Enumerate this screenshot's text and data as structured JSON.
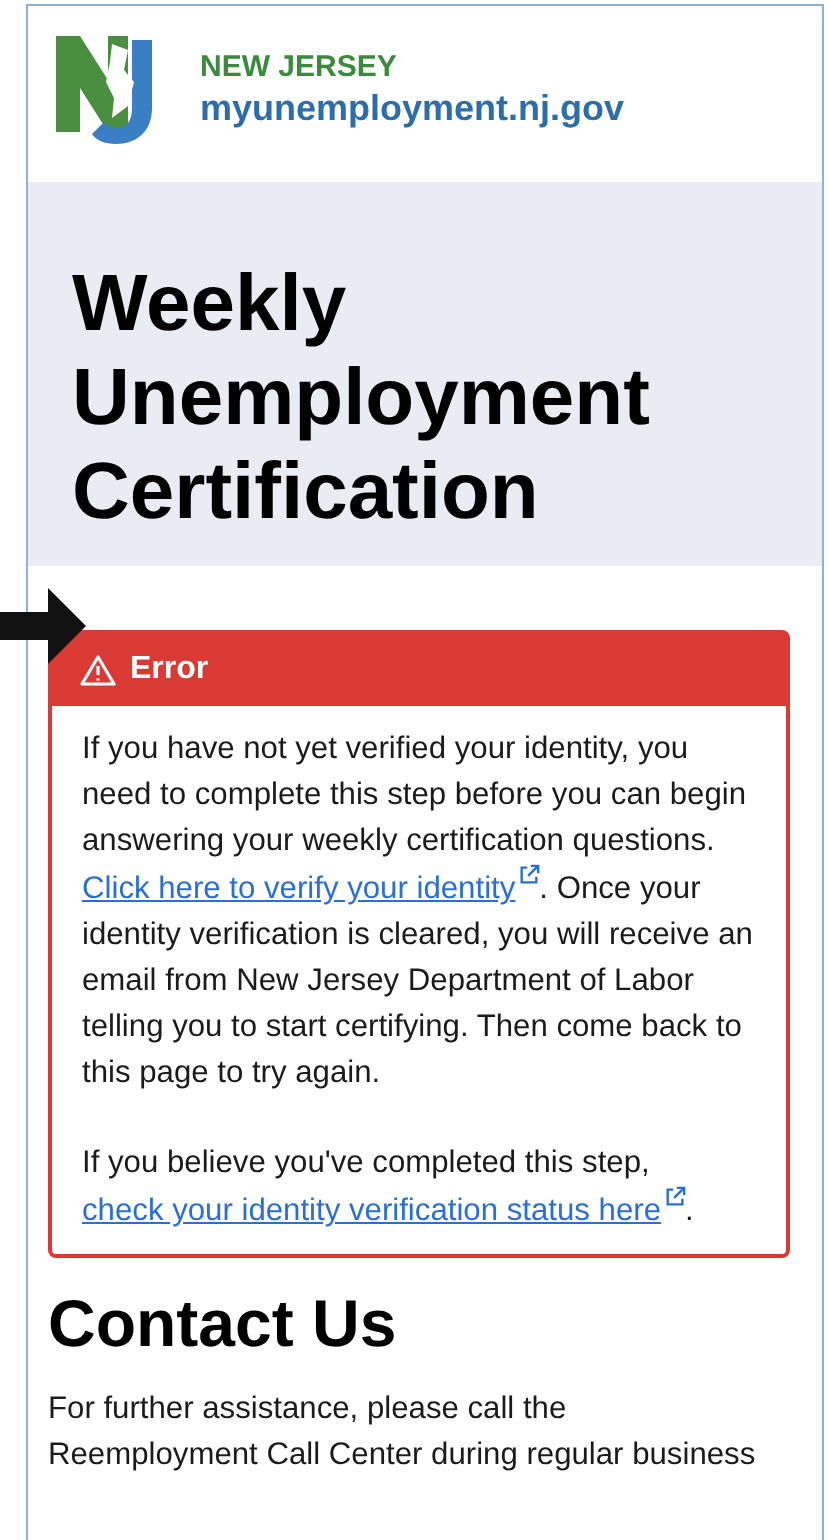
{
  "header": {
    "state": "NEW JERSEY",
    "site": "myunemployment.nj.gov"
  },
  "page_title": "Weekly Unemployment Certification",
  "alert": {
    "kind": "error",
    "title": "Error",
    "paragraphs": [
      [
        {
          "kind": "text",
          "text": "If you have not yet verified your identity, you need to complete this step before you can begin answering your weekly certification questions. "
        },
        {
          "kind": "link",
          "text": "Click here to verify your identity"
        },
        {
          "kind": "text",
          "text": ". Once your identity verification is cleared, you will receive an email from New Jersey Department of Labor telling you to start certifying. Then come back to this page to try again."
        }
      ],
      [
        {
          "kind": "text",
          "text": "If you believe you've completed this step, "
        },
        {
          "kind": "link",
          "text": "check your identity verification status here"
        },
        {
          "kind": "text",
          "text": "."
        }
      ]
    ]
  },
  "contact": {
    "heading": "Contact Us",
    "text": "For further assistance, please call the Reemployment Call Center during regular business"
  }
}
